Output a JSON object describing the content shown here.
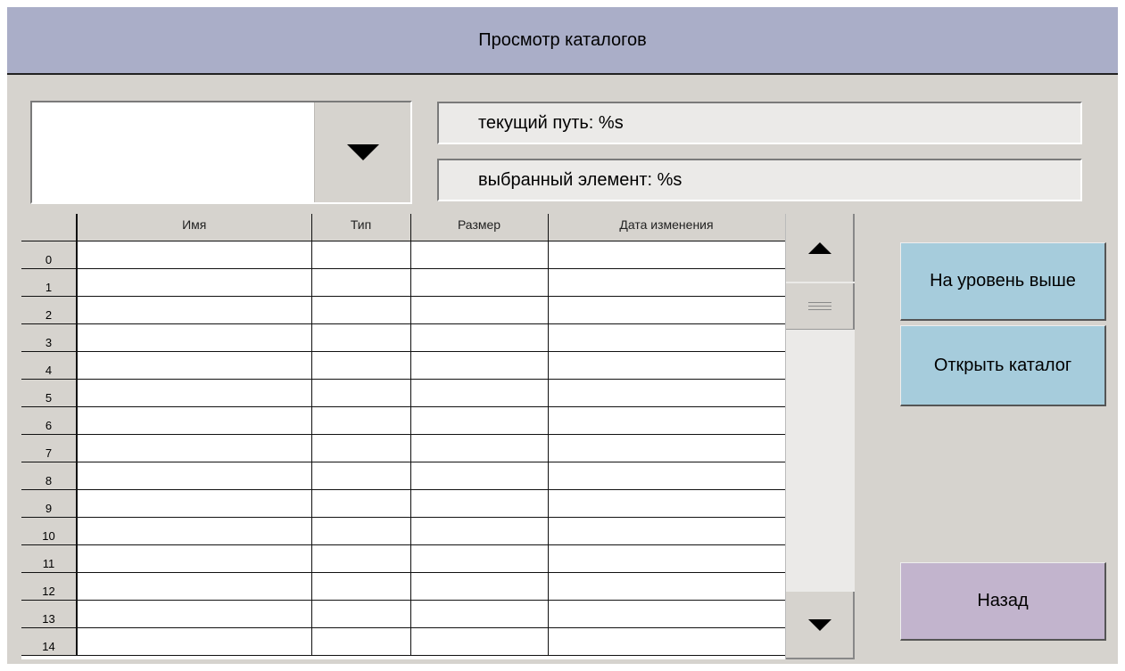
{
  "window": {
    "title": "Просмотр каталогов"
  },
  "combo": {
    "value": "",
    "toggle_icon": "triangle-down-icon"
  },
  "info": {
    "current_path": "текущий путь: %s",
    "selected_item": "выбранный элемент: %s"
  },
  "table": {
    "columns": [
      "Имя",
      "Тип",
      "Размер",
      "Дата изменения"
    ],
    "row_numbers": [
      "0",
      "1",
      "2",
      "3",
      "4",
      "5",
      "6",
      "7",
      "8",
      "9",
      "10",
      "11",
      "12",
      "13",
      "14"
    ]
  },
  "buttons": {
    "up_level": "На уровень выше",
    "open_dir": "Открыть каталог",
    "back": "Назад"
  },
  "colors": {
    "titlebar": "#aaaec8",
    "panel": "#d6d3ce",
    "blue_button": "#a6ccdc",
    "purple_button": "#c2b4cd"
  }
}
